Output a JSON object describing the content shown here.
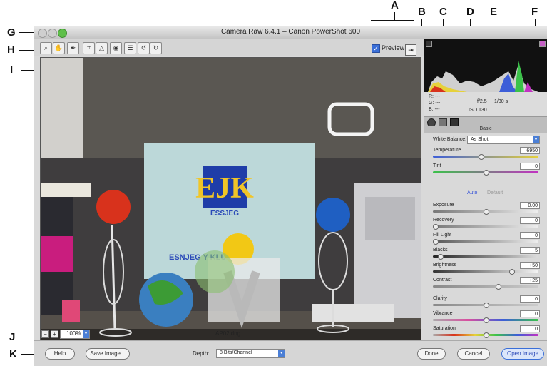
{
  "callouts": {
    "A": "A",
    "B": "B",
    "C": "C",
    "D": "D",
    "E": "E",
    "F": "F",
    "G": "G",
    "H": "H",
    "I": "I",
    "J": "J",
    "K": "K"
  },
  "window": {
    "title": "Camera Raw 6.4.1  –  Canon PowerShot 600"
  },
  "toolbar": {
    "tools": [
      {
        "icon": "zoom-tool-icon",
        "glyph": "⌕"
      },
      {
        "icon": "hand-tool-icon",
        "glyph": "✋"
      },
      {
        "icon": "white-balance-tool-icon",
        "glyph": "✒"
      },
      {
        "icon": "crop-tool-icon",
        "glyph": "⌗"
      },
      {
        "icon": "straighten-tool-icon",
        "glyph": "△"
      },
      {
        "icon": "red-eye-tool-icon",
        "glyph": "◉"
      },
      {
        "icon": "preferences-icon",
        "glyph": "☰"
      },
      {
        "icon": "rotate-left-icon",
        "glyph": "↺"
      },
      {
        "icon": "rotate-right-icon",
        "glyph": "↻"
      }
    ],
    "preview_label": "Preview",
    "preview_checked": true
  },
  "status": {
    "zoom": "100%",
    "filename": "AP02.dng"
  },
  "readout": {
    "r": "R:",
    "g": "G:",
    "b": "B:",
    "dash": "---",
    "aperture": "f/2.5",
    "shutter": "1/30 s",
    "iso": "ISO 130"
  },
  "panel": {
    "title": "Basic",
    "white_balance_label": "White Balance:",
    "white_balance_value": "As Shot",
    "auto_label": "Auto",
    "default_label": "Default",
    "sliders": [
      {
        "label": "Temperature",
        "value": "6950",
        "pos": 0.45
      },
      {
        "label": "Tint",
        "value": "0",
        "pos": 0.5
      },
      {
        "label": "Exposure",
        "value": "0.00",
        "pos": 0.5
      },
      {
        "label": "Recovery",
        "value": "0",
        "pos": 0.0
      },
      {
        "label": "Fill Light",
        "value": "0",
        "pos": 0.0
      },
      {
        "label": "Blacks",
        "value": "5",
        "pos": 0.05
      },
      {
        "label": "Brightness",
        "value": "+50",
        "pos": 0.75
      },
      {
        "label": "Contrast",
        "value": "+25",
        "pos": 0.62
      },
      {
        "label": "Clarity",
        "value": "0",
        "pos": 0.5
      },
      {
        "label": "Vibrance",
        "value": "0",
        "pos": 0.5
      },
      {
        "label": "Saturation",
        "value": "0",
        "pos": 0.5
      }
    ]
  },
  "bottom": {
    "help": "Help",
    "save": "Save Image...",
    "depth_label": "Depth:",
    "depth_value": "8 Bits/Channel",
    "done": "Done",
    "cancel": "Cancel",
    "open": "Open Image"
  },
  "photo": {
    "sign_text": "EJK",
    "sign_sub": "ESSJEG",
    "banner": "ESNJEG      Y KLUB"
  },
  "colors": {
    "accent": "#3a6fd8",
    "red_ball": "#d8321c",
    "blue_ball": "#1f5fc2",
    "yellow_ball": "#f2c815"
  }
}
